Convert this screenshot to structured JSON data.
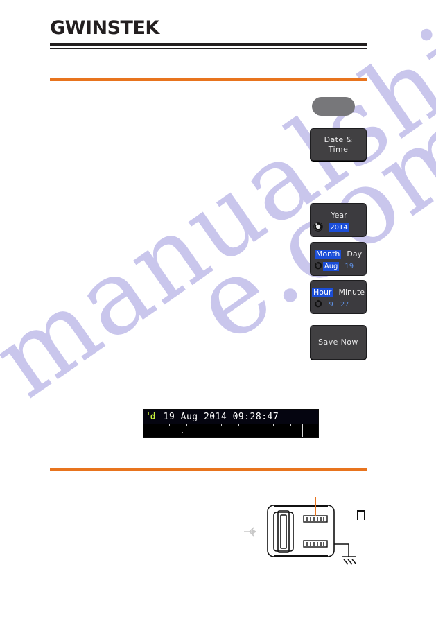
{
  "brand": {
    "logo_text": "GWINSTEK",
    "logo_part1": "GW",
    "logo_part2": "INSTEK"
  },
  "colors": {
    "accent_orange": "#e8741e",
    "panel_dark": "#414042",
    "panel_value": "#3c3b3f",
    "select_blue": "#1b4ed8",
    "value_blue": "#5e8fe0",
    "trigger_green": "#c7f03c",
    "watermark": "#c9c6ec",
    "rule_grey": "#808080"
  },
  "watermark": {
    "line1": "manualshive",
    "line2": "e.com"
  },
  "softkeys": {
    "blank_pill": "",
    "date_time": {
      "line1": "Date &",
      "line2": "Time"
    },
    "save_now": "Save Now"
  },
  "value_keys": [
    {
      "name": "year",
      "icon": "rotary-knob-icon",
      "fields": [
        {
          "label": "Year",
          "label_selected": false,
          "value": "2014",
          "value_selected": true
        }
      ]
    },
    {
      "name": "month-day",
      "icon": "rotary-knob-icon",
      "fields": [
        {
          "label": "Month",
          "label_selected": true,
          "value": "Aug",
          "value_selected": true
        },
        {
          "label": "Day",
          "label_selected": false,
          "value": "19",
          "value_selected": false
        }
      ]
    },
    {
      "name": "hour-minute",
      "icon": "rotary-knob-icon",
      "fields": [
        {
          "label": "Hour",
          "label_selected": true,
          "value": "9",
          "value_selected": false
        },
        {
          "label": "Minute",
          "label_selected": false,
          "value": "27",
          "value_selected": false
        }
      ]
    }
  ],
  "scope_display": {
    "trigger_status": "'d",
    "datetime": "19 Aug 2014 09:28:47",
    "date_day": "19",
    "date_month": "Aug",
    "date_year": "2014",
    "time": "09:28:47"
  },
  "diagram": {
    "usb_icon": "usb-icon",
    "ground_symbol": "ground-icon",
    "square_wave": "square-wave-icon",
    "connector": "usb-port-icon"
  }
}
